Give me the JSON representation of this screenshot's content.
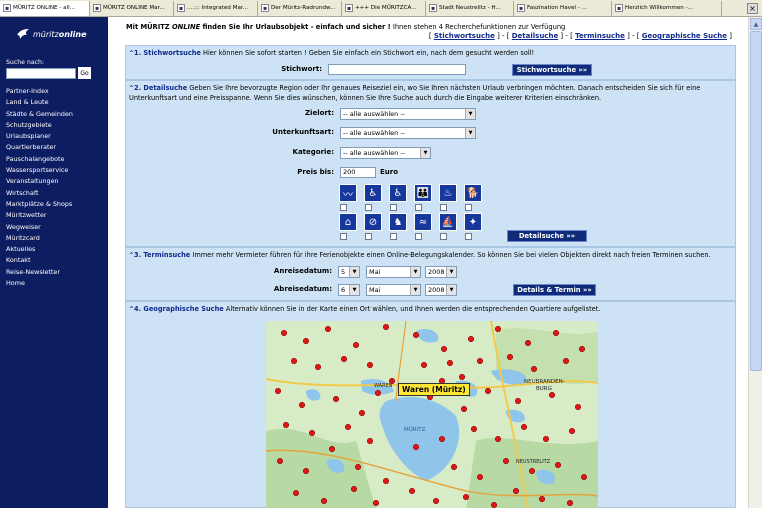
{
  "tabs": [
    {
      "label": "MÜRITZ ONLINE - all...",
      "icon": "page-icon"
    },
    {
      "label": "MÜRITZ ONLINE Mar...",
      "icon": "page-icon"
    },
    {
      "label": "....::: Integrated Mar...",
      "icon": "page-icon"
    },
    {
      "label": "Der Müritz-Radrundw...",
      "icon": "page-icon"
    },
    {
      "label": "+++ Die MÜRITZCA...",
      "icon": "page-icon"
    },
    {
      "label": "Stadt Neustrelitz - H...",
      "icon": "page-icon"
    },
    {
      "label": "Faszination Havel - ...",
      "icon": "page-icon"
    },
    {
      "label": "Herzlich Willkommen -...",
      "icon": "page-icon"
    }
  ],
  "sidebar": {
    "logo_prefix": "müritz",
    "logo_suffix": "online",
    "search_label": "Suche nach:",
    "search_value": "",
    "go_label": "Go",
    "nav": [
      "Partner-Index",
      "Land & Leute",
      "Städte & Gemeinden",
      "Schutzgebiete",
      "Urlaubsplaner",
      "Quartierberater",
      "Pauschalangebote",
      "Wassersportservice",
      "Veranstaltungen",
      "Wirtschaft",
      "Marktplätze & Shops",
      "Müritzwetter",
      "Wegweiser",
      "Müritzcard",
      "Aktuelles",
      "Kontakt",
      "Reise-Newsletter",
      "Home"
    ]
  },
  "intro": {
    "lead": "Mit MÜRITZ ",
    "lead_italic": "ONLINE",
    "bold_rest": " finden Sie Ihr Urlaubsobjekt - einfach und sicher !",
    "normal": " Ihnen stehen 4 Recherchefunktionen zur Verfügung"
  },
  "quicklinks": {
    "open": "[ ",
    "sep": " ] - [ ",
    "close": " ]",
    "items": [
      "Stichwortsuche",
      "Detailsuche",
      "Terminsuche",
      "Geographische Suche"
    ]
  },
  "sec1": {
    "title": "1. Stichwortsuche",
    "desc": " Hier können Sie sofort starten ! Geben Sie einfach ein Stichwort ein, nach dem gesucht werden soll!",
    "field_label": "Stichwort:",
    "field_value": "",
    "button": "Stichwortsuche »»"
  },
  "sec2": {
    "title": "2. Detailsuche",
    "desc": " Geben Sie Ihre bevorzugte Region oder Ihr genaues Reiseziel ein, wo Sie Ihren nächsten Urlaub verbringen möchten. Danach entscheiden Sie sich für eine Unterkunftsart und eine Preisspanne. Wenn Sie dies wünschen, können Sie Ihre Suche auch durch die Eingabe weiterer Kriterien einschränken.",
    "zielort_label": "Zielort:",
    "zielort_value": "-- alle auswählen --",
    "unterkunft_label": "Unterkunftsart:",
    "unterkunft_value": "-- alle auswählen --",
    "kategorie_label": "Kategorie:",
    "kategorie_value": "-- alle auswählen --",
    "preis_label": "Preis bis:",
    "preis_value": "200",
    "preis_unit": "Euro",
    "amenities_row1": [
      "swimming-icon",
      "wheelchair-helper-icon",
      "wheelchair-icon",
      "family-icon",
      "sauna-icon",
      "dog-icon"
    ],
    "amenities_row2": [
      "playground-icon",
      "no-smoking-icon",
      "horse-icon",
      "beach-icon",
      "boat-icon",
      "fitness-icon"
    ],
    "button": "Detailsuche »»"
  },
  "sec3": {
    "title": "3. Terminsuche",
    "desc": " Immer mehr Vermieter führen für ihre Ferienobjekte einen Online-Belegungskalender. So können Sie bei vielen Objekten direkt nach freien Terminen suchen.",
    "arrival_label": "Anreisedatum:",
    "arrival_day": "5",
    "arrival_month": "Mai",
    "arrival_year": "2008",
    "departure_label": "Abreisedatum:",
    "departure_day": "6",
    "departure_month": "Mai",
    "departure_year": "2008",
    "button": "Details & Termin »»"
  },
  "sec4": {
    "title": "4. Geographische Suche",
    "desc": " Alternativ können Sie in der Karte einen Ort wählen, und Ihnen werden die entsprechenden Quartiere aufgelistet.",
    "map_label": "Waren (Müritz)",
    "map_place_1": "NEUBRANDEN-",
    "map_place_2": "BURG",
    "map_place_3": "MÜRITZ",
    "map_place_4": "NEUSTRELITZ",
    "map_place_5": "WAREN"
  },
  "colors": {
    "sidebar_bg": "#0c1d62",
    "section_bg": "#cde3f5",
    "accent": "#0f2a8a",
    "button_bg": "#0e2a78",
    "map_pin": "#e01818"
  }
}
